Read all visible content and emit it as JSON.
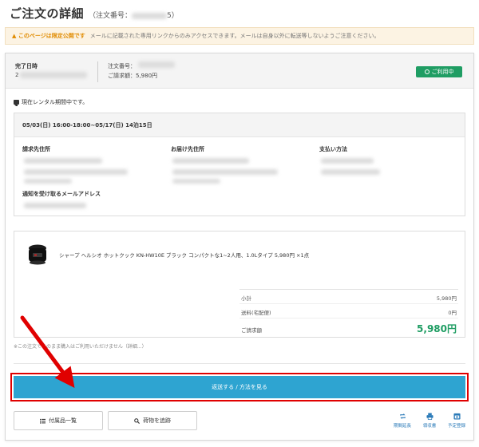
{
  "page": {
    "title": "ご注文の詳細",
    "order_number_label": "（注文番号：",
    "order_number_tail": "5）"
  },
  "notice": {
    "warning": "このページは限定公開です",
    "text": "メールに記載された専用リンクからのみアクセスできます。メールは自身以外に転送等しないようご注意ください。"
  },
  "status": {
    "completed_label": "完了日時",
    "completed_prefix": "2",
    "order_no_label": "注文番号：",
    "billed": "ご請求額：5,980円",
    "badge": "ご利用中",
    "badge_color": "#1f9d63"
  },
  "rental": {
    "message": "現在レンタル期間中です。"
  },
  "details": {
    "period": "05/03(日) 16:00-18:00~05/17(日) 14泊15日",
    "billing_label": "請求先住所",
    "shipping_label": "お届け先住所",
    "payment_label": "支払い方法",
    "email_label": "通知を受け取るメールアドレス"
  },
  "product": {
    "name": "シャープ ヘルシオ ホットクック KN-HW10E ブラック コンパクトな1~2人用、1.0Lタイプ 5,980円 ×1点"
  },
  "totals": {
    "subtotal_label": "小計",
    "subtotal": "5,980円",
    "shipping_label": "送料(宅配便)",
    "shipping": "0円",
    "total_label": "ご請求額",
    "total": "5,980円",
    "accent_color": "#1f9d63"
  },
  "note": "※この注文でこのまま購入はご利用いただけません（詳細...）",
  "cta": {
    "label": "返送する / 方法を見る",
    "color": "#2ea4d1",
    "highlight_color": "#e00000"
  },
  "buttons": {
    "accessories": "付属品一覧",
    "track": "荷物を追跡"
  },
  "actions": {
    "extend": "期間延長",
    "receipt": "領収書",
    "schedule": "予定登録"
  },
  "annotation": {
    "arrow_color": "#e00000"
  }
}
